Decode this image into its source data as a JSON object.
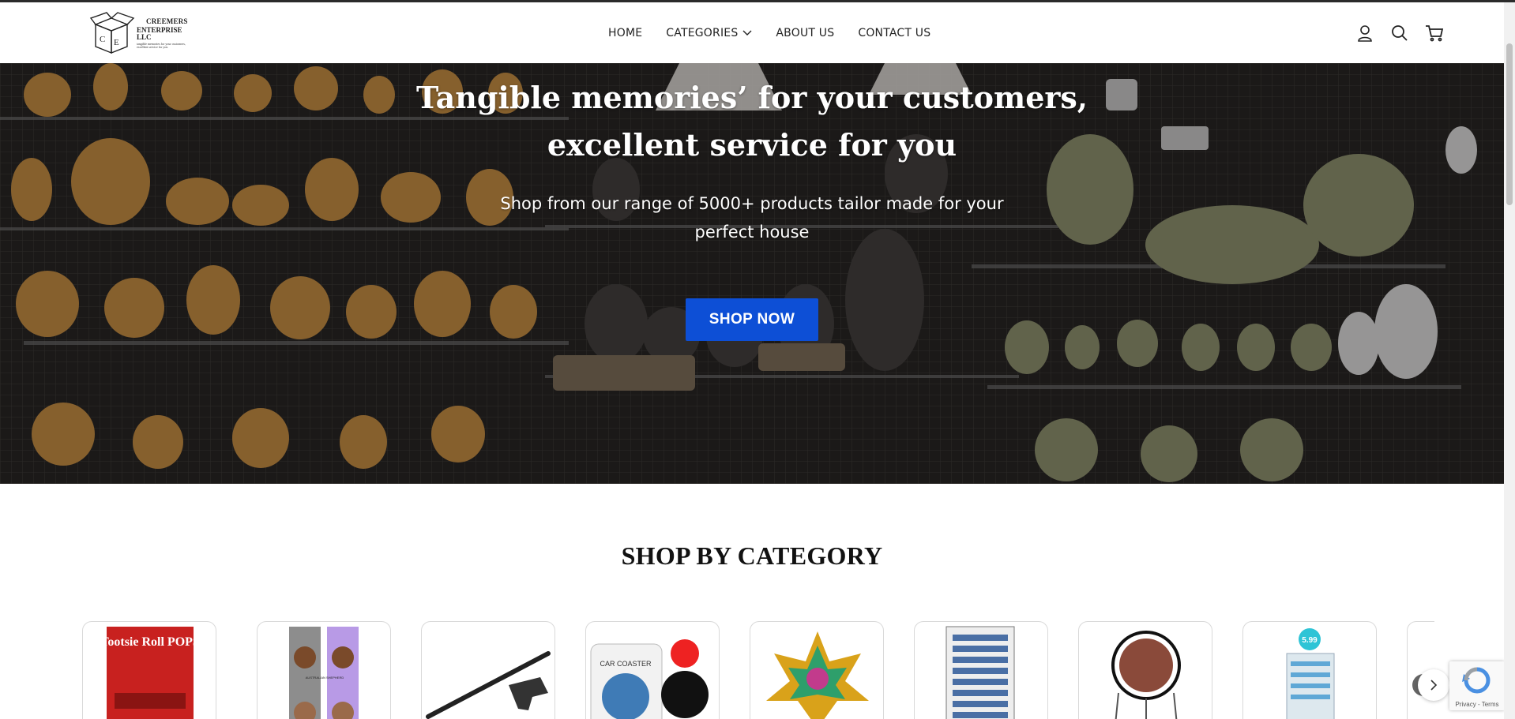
{
  "brand": {
    "line1": "CREEMERS",
    "line2": "ENTERPRISE LLC",
    "tagline": "tangible memories for your customers, excellent service for you",
    "monogram": [
      "C",
      "E"
    ]
  },
  "nav": {
    "items": [
      {
        "label": "HOME"
      },
      {
        "label": "CATEGORIES",
        "has_dropdown": true
      },
      {
        "label": "ABOUT US"
      },
      {
        "label": "CONTACT US"
      }
    ]
  },
  "header_icons": [
    "account-icon",
    "search-icon",
    "cart-icon"
  ],
  "hero": {
    "title": "Tangible memories’ for your customers, excellent service for you",
    "subtitle": "Shop from our range of 5000+ products tailor made for your perfect house",
    "cta_label": "SHOP NOW",
    "cta_color": "#0d4fd6"
  },
  "categories_section": {
    "title": "SHOP BY CATEGORY",
    "cards": [
      {
        "name": "tootsie-roll-pops",
        "label_text": "Tootsie Roll POPS"
      },
      {
        "name": "dog-socks",
        "label_text": "AUSTRALIAN SHEPHERD"
      },
      {
        "name": "gun-cane"
      },
      {
        "name": "car-coaster",
        "label_text": "CAR COASTER"
      },
      {
        "name": "crystal-lotus"
      },
      {
        "name": "pocket-knives-display"
      },
      {
        "name": "dream-catcher"
      },
      {
        "name": "display-rack",
        "label_text": "5.99"
      },
      {
        "name": "partial-card"
      }
    ]
  },
  "recaptcha": {
    "links": "Privacy - Terms"
  }
}
